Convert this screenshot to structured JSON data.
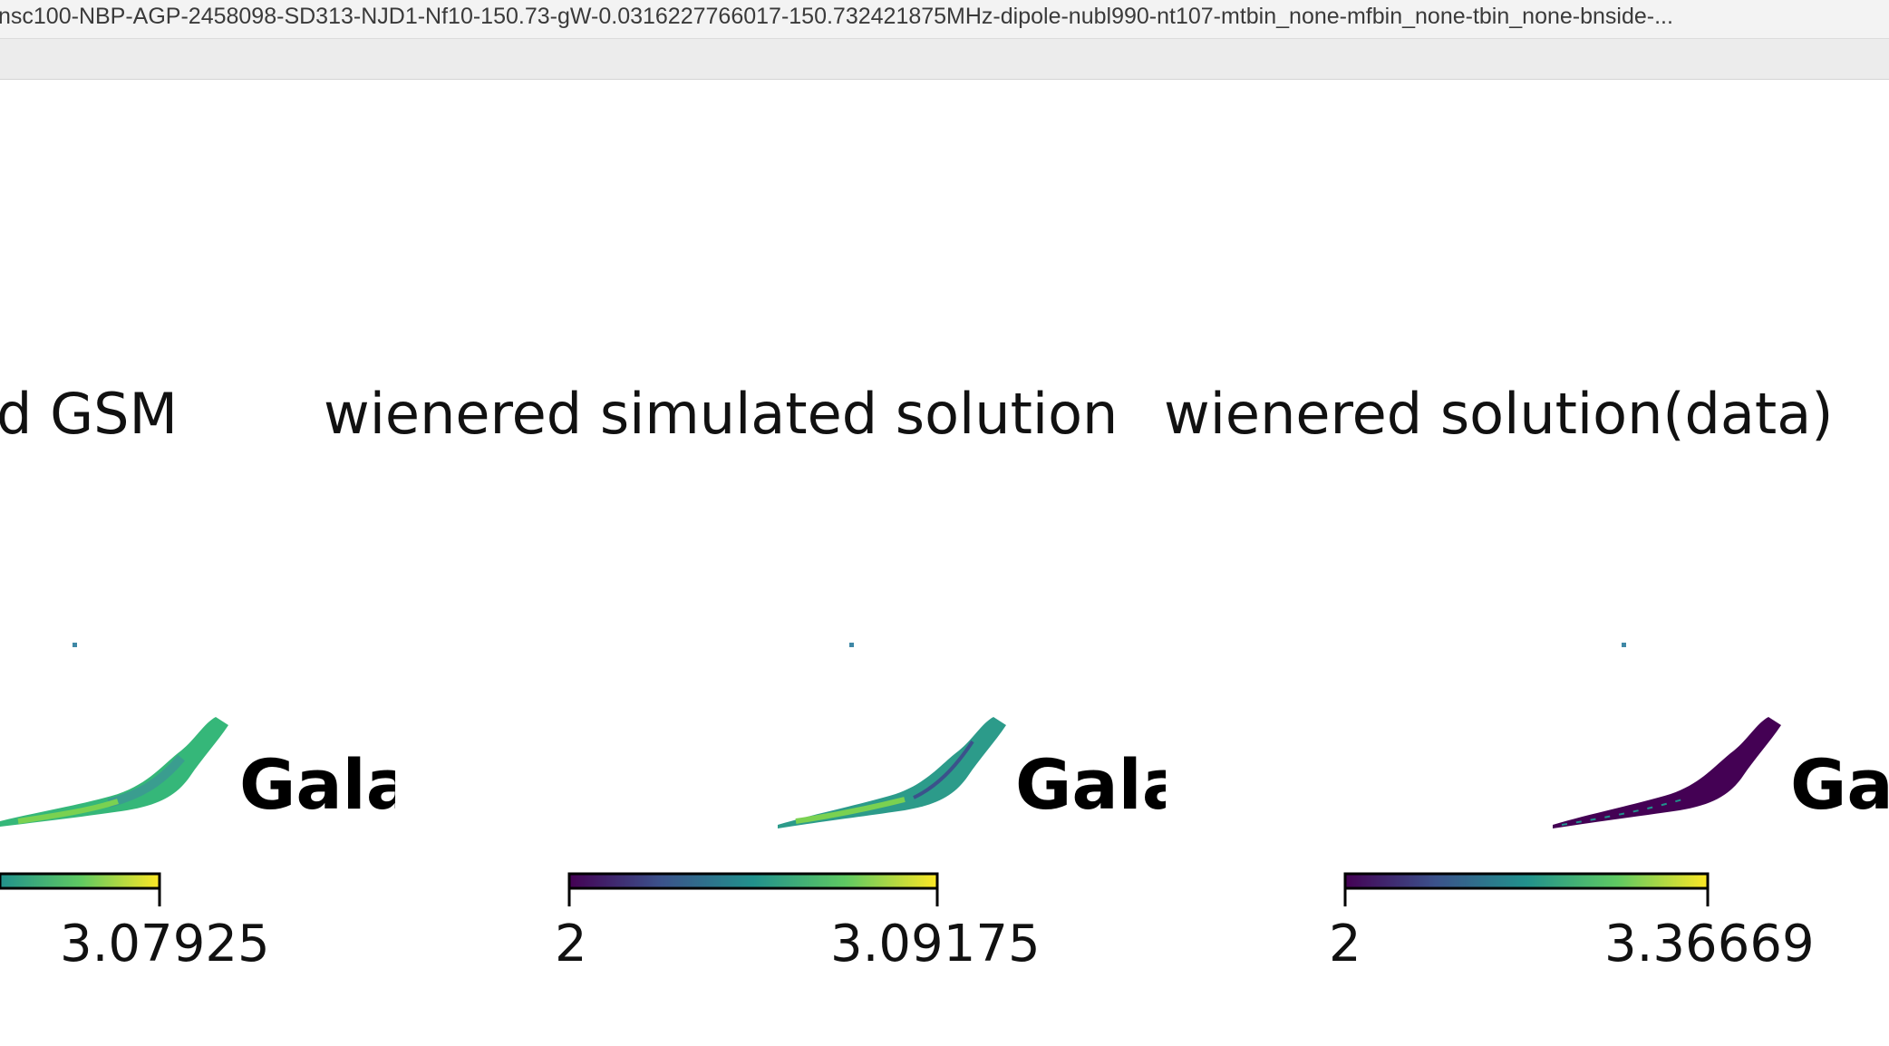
{
  "window": {
    "title": "nsc100-NBP-AGP-2458098-SD313-NJD1-Nf10-150.73-gW-0.0316227766017-150.732421875MHz-dipole-nubl990-nt107-mtbin_none-mfbin_none-tbin_none-bnside-..."
  },
  "panels": [
    {
      "title": "d GSM",
      "gal_label": "Gala",
      "colorbar": {
        "min_label": "",
        "max_label": "3.07925",
        "colormap": "viridis"
      },
      "map_color": "#35b779"
    },
    {
      "title": "wienered simulated solution",
      "gal_label": "Gala",
      "colorbar": {
        "min_label": "2",
        "max_label": "3.09175",
        "colormap": "viridis"
      },
      "map_color": "#2c9b8a"
    },
    {
      "title": "wienered solution(data)",
      "gal_label": "Gala",
      "colorbar": {
        "min_label": "2",
        "max_label": "3.36669",
        "colormap": "viridis"
      },
      "map_color": "#440154"
    }
  ],
  "colors": {
    "viridis_start": "#440154",
    "viridis_mid": "#21918c",
    "viridis_end": "#fde725"
  }
}
